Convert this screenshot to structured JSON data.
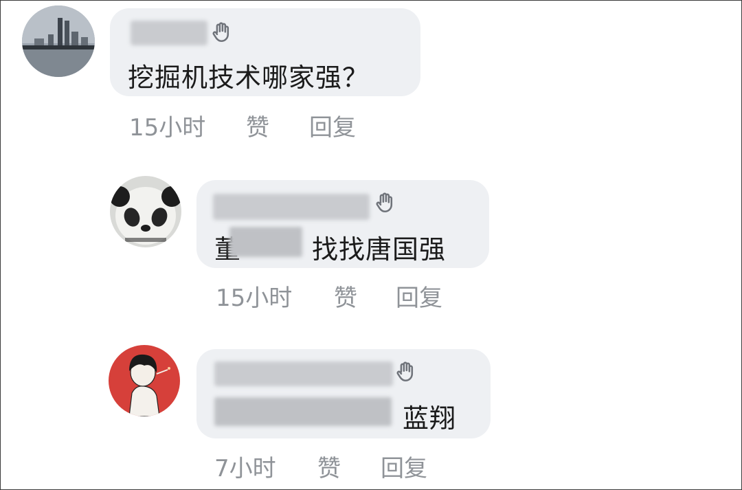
{
  "comments": [
    {
      "message": "挖掘机技术哪家强？",
      "time": "15小时",
      "like_label": "赞",
      "reply_label": "回复",
      "avatar_icon": "city-skyline-avatar",
      "hand_icon": "waving-hand-icon"
    },
    {
      "message_prefix": "董",
      "message": "找找唐国强",
      "time": "15小时",
      "like_label": "赞",
      "reply_label": "回复",
      "avatar_icon": "panda-avatar",
      "hand_icon": "waving-hand-icon"
    },
    {
      "message": "蓝翔",
      "time": "7小时",
      "like_label": "赞",
      "reply_label": "回复",
      "avatar_icon": "red-anime-boy-avatar",
      "hand_icon": "waving-hand-icon"
    }
  ],
  "colors": {
    "bubble": "#eef0f3",
    "meta_text": "#8f9398",
    "message_text": "#1b1b1b"
  }
}
